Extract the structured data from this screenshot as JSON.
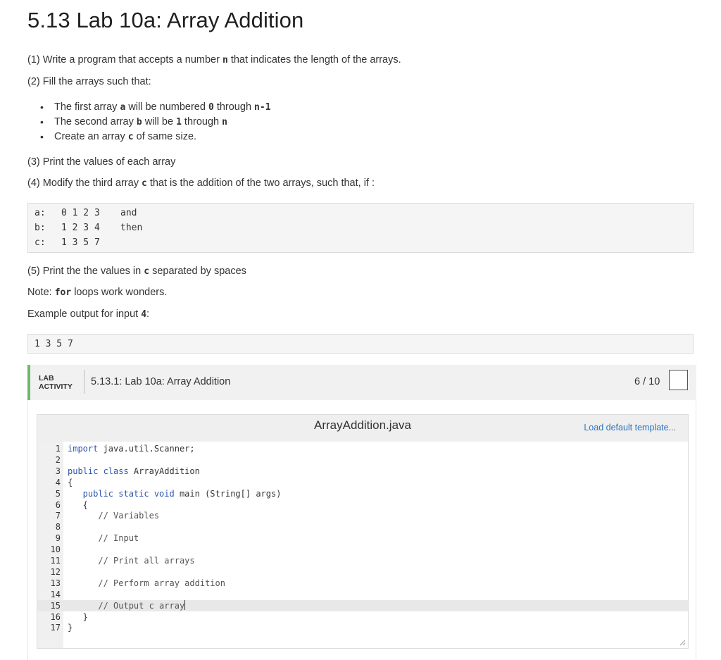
{
  "title": "5.13 Lab 10a: Array Addition",
  "instructions": {
    "p1_pre": "(1) Write a program that accepts a number ",
    "p1_code": "n",
    "p1_post": " that indicates the length of the arrays.",
    "p2": "(2) Fill the arrays such that:",
    "bullets": [
      {
        "pre": "The first array ",
        "c1": "a",
        "mid": " will be numbered ",
        "c2": "0",
        "mid2": " through ",
        "c3": "n-1"
      },
      {
        "pre": "The second array ",
        "c1": "b",
        "mid": " will be ",
        "c2": "1",
        "mid2": " through ",
        "c3": "n"
      },
      {
        "pre": "Create an array ",
        "c1": "c",
        "post": " of same size."
      }
    ],
    "p3": "(3) Print the values of each array",
    "p4_pre": "(4) Modify the third array ",
    "p4_code": "c",
    "p4_post": " that is the addition of the two arrays, such that, if :",
    "table": [
      {
        "label": "a:",
        "values": "0 1 2 3",
        "note": "and"
      },
      {
        "label": "b:",
        "values": "1 2 3 4",
        "note": "then"
      },
      {
        "label": "c:",
        "values": "1 3 5 7",
        "note": ""
      }
    ],
    "p5_pre": "(5) Print the the values in ",
    "p5_code": "c",
    "p5_post": " separated by spaces",
    "note_pre": "Note: ",
    "note_code": "for",
    "note_post": " loops work wonders.",
    "example_pre": "Example output for input ",
    "example_code": "4",
    "example_post": ":",
    "example_output": "1 3 5 7"
  },
  "lab": {
    "tag_line1": "LAB",
    "tag_line2": "ACTIVITY",
    "title": "5.13.1: Lab 10a: Array Addition",
    "score": "6 / 10",
    "accent_color": "#6cb96c"
  },
  "editor": {
    "filename": "ArrayAddition.java",
    "load_template": "Load default template...",
    "lines": [
      {
        "n": "1",
        "kw": "import",
        "text": " java.util.Scanner;"
      },
      {
        "n": "2",
        "kw": "",
        "text": ""
      },
      {
        "n": "3",
        "kw": "public class",
        "text": " ArrayAddition"
      },
      {
        "n": "4",
        "kw": "",
        "text": "{"
      },
      {
        "n": "5",
        "kw": "   public static void",
        "text": " main (String[] args)"
      },
      {
        "n": "6",
        "kw": "",
        "text": "   {"
      },
      {
        "n": "7",
        "kw": "",
        "cm": "      // Variables"
      },
      {
        "n": "8",
        "kw": "",
        "text": ""
      },
      {
        "n": "9",
        "kw": "",
        "cm": "      // Input"
      },
      {
        "n": "10",
        "kw": "",
        "text": ""
      },
      {
        "n": "11",
        "kw": "",
        "cm": "      // Print all arrays"
      },
      {
        "n": "12",
        "kw": "",
        "text": ""
      },
      {
        "n": "13",
        "kw": "",
        "cm": "      // Perform array addition"
      },
      {
        "n": "14",
        "kw": "",
        "text": ""
      },
      {
        "n": "15",
        "kw": "",
        "cm": "      // Output c array"
      },
      {
        "n": "16",
        "kw": "",
        "text": "   }"
      },
      {
        "n": "17",
        "kw": "",
        "text": "}"
      }
    ],
    "active_line": "15"
  }
}
